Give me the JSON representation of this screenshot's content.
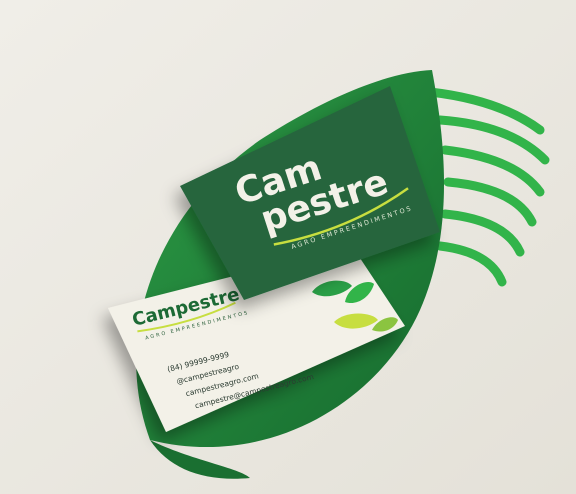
{
  "brand": {
    "front_line1": "Cam",
    "front_line2": "pestre",
    "back_name": "Campestre",
    "tagline": "AGRO EMPREENDIMENTOS"
  },
  "contact": {
    "phone": "(84) 99999-9999",
    "social": "@campestreagro",
    "website": "campestreagro.com",
    "email": "campestre@campestreagro.com"
  },
  "colors": {
    "background": "#ebe8e1",
    "leaf_dark": "#1f7a38",
    "card_front": "#25653d",
    "card_back": "#f3f1e8",
    "accent_lime": "#c7de3f",
    "accent_green": "#32b44a"
  }
}
